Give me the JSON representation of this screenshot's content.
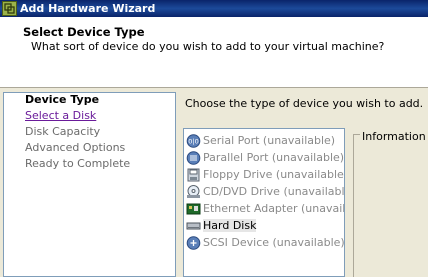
{
  "window": {
    "title": "Add Hardware Wizard"
  },
  "header": {
    "title": "Select Device Type",
    "subtitle": "What sort of device do you wish to add to your virtual machine?"
  },
  "steps": [
    {
      "label": "Device Type",
      "state": "current"
    },
    {
      "label": "Select a Disk",
      "state": "link"
    },
    {
      "label": "Disk Capacity",
      "state": "disabled"
    },
    {
      "label": "Advanced Options",
      "state": "disabled"
    },
    {
      "label": "Ready to Complete",
      "state": "disabled"
    }
  ],
  "prompt": "Choose the type of device you wish to add.",
  "devices": [
    {
      "label": "Serial Port (unavailable)",
      "icon": "serial-port-icon",
      "available": false
    },
    {
      "label": "Parallel Port (unavailable)",
      "icon": "parallel-port-icon",
      "available": false
    },
    {
      "label": "Floppy Drive (unavailable)",
      "icon": "floppy-drive-icon",
      "available": false
    },
    {
      "label": "CD/DVD Drive (unavailable)",
      "icon": "cd-dvd-drive-icon",
      "available": false
    },
    {
      "label": "Ethernet Adapter (unavailabl",
      "icon": "ethernet-adapter-icon",
      "available": false
    },
    {
      "label": "Hard Disk",
      "icon": "hard-disk-icon",
      "available": true,
      "selected": true
    },
    {
      "label": "SCSI Device (unavailable)",
      "icon": "scsi-device-icon",
      "available": false
    }
  ],
  "info": {
    "legend": "Information"
  },
  "colors": {
    "titlebar": "#0a246a",
    "link": "#6a1b9a",
    "unavailable_text": "#8a8a8a"
  }
}
